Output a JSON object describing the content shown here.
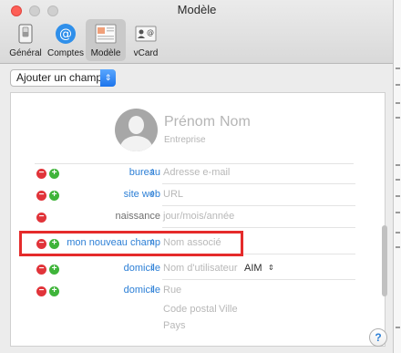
{
  "window": {
    "title": "Modèle"
  },
  "toolbar": [
    {
      "label": "Général",
      "icon": "switch-icon"
    },
    {
      "label": "Comptes",
      "icon": "at-icon"
    },
    {
      "label": "Modèle",
      "icon": "template-icon",
      "selected": true
    },
    {
      "label": "vCard",
      "icon": "vcard-icon"
    }
  ],
  "add_field": {
    "label": "Ajouter un champ"
  },
  "card": {
    "first_name_placeholder": "Prénom",
    "last_name_placeholder": "Nom",
    "company_placeholder": "Entreprise",
    "rows": [
      {
        "label": "bureau",
        "value": "Adresse e-mail"
      },
      {
        "label": "site web",
        "value": "URL"
      },
      {
        "label": "naissance",
        "value": "jour/mois/année"
      },
      {
        "label": "mon nouveau champ",
        "value": "Nom associé"
      },
      {
        "label": "domicile",
        "value": "Nom d'utilisateur",
        "service": "AIM"
      },
      {
        "label": "domicile",
        "address": [
          "Rue",
          "Code postal",
          "Ville",
          "Pays"
        ]
      }
    ]
  },
  "help": {
    "label": "?"
  }
}
